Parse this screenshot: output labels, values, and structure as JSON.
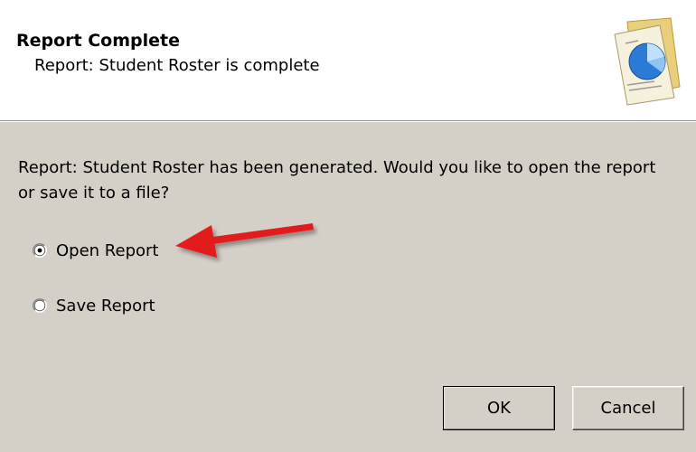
{
  "dialog": {
    "title": "Report Complete",
    "subtitle": "Report: Student Roster is complete",
    "icon": "report-document-icon",
    "message": "Report: Student Roster has been generated. Would you like to open the report or save it to a file?"
  },
  "options": [
    {
      "label": "Open Report",
      "selected": true
    },
    {
      "label": "Save Report",
      "selected": false
    }
  ],
  "buttons": {
    "ok_label": "OK",
    "cancel_label": "Cancel"
  },
  "annotation": {
    "icon": "red-arrow-icon",
    "color": "#e21b1b"
  },
  "colors": {
    "dialog_bg": "#d4d0c8",
    "header_bg": "#ffffff"
  }
}
